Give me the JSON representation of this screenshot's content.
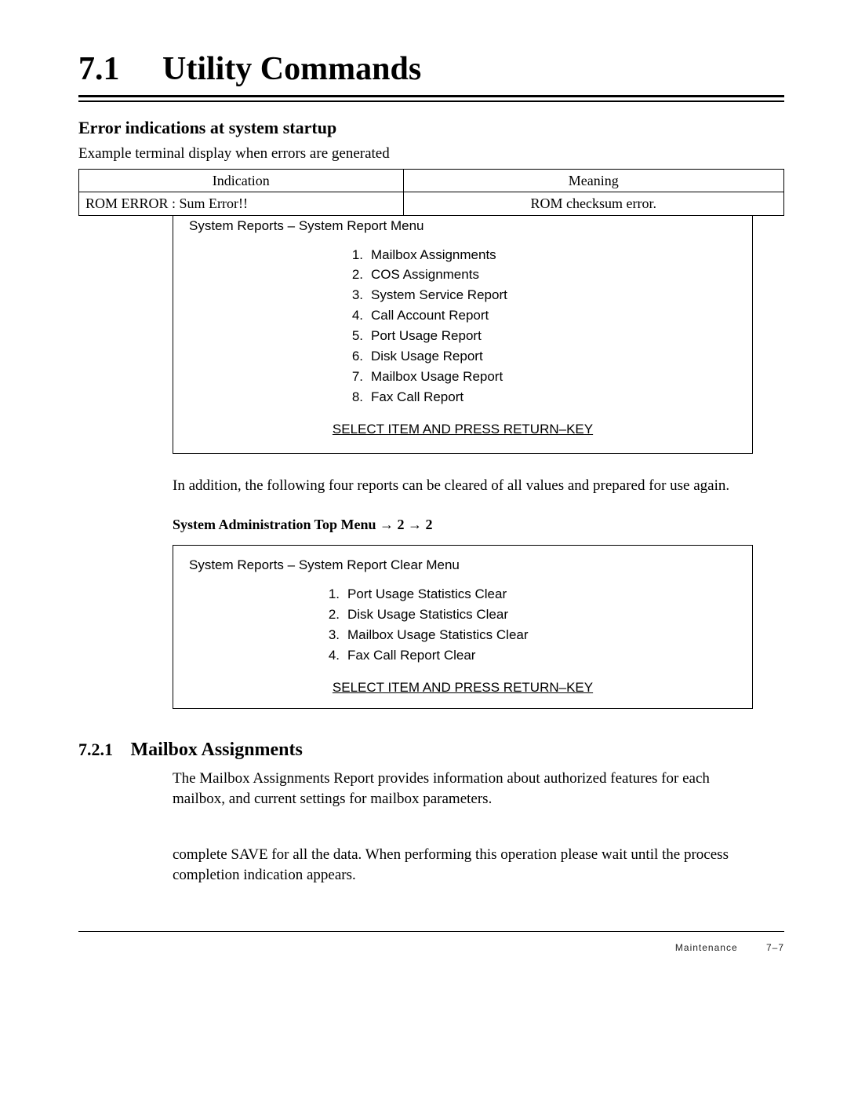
{
  "header": {
    "number": "7.1",
    "title": "Utility Commands"
  },
  "sub1": {
    "title": "Error indications at system startup",
    "intro": "Example terminal display when errors are generated"
  },
  "error_table": {
    "head_indication": "Indication",
    "head_meaning": "Meaning",
    "row_indication": "ROM ERROR : Sum Error!!",
    "row_meaning": "ROM checksum error."
  },
  "terminal1": {
    "title": "System Reports – System Report Menu",
    "items": [
      {
        "n": "1.",
        "label": "Mailbox Assignments"
      },
      {
        "n": "2.",
        "label": "COS Assignments"
      },
      {
        "n": "3.",
        "label": "System Service Report"
      },
      {
        "n": "4.",
        "label": "Call Account Report"
      },
      {
        "n": "5.",
        "label": "Port Usage Report"
      },
      {
        "n": "6.",
        "label": "Disk Usage Report"
      },
      {
        "n": "7.",
        "label": "Mailbox Usage Report"
      },
      {
        "n": "8.",
        "label": "Fax Call Report"
      }
    ],
    "select": "SELECT ITEM AND PRESS RETURN–KEY"
  },
  "para1": "In addition, the following four reports can be cleared of all values and prepared for use again.",
  "menu_path": "System Administration Top Menu → 2 → 2",
  "terminal2": {
    "title": "System Reports – System Report Clear Menu",
    "items": [
      {
        "n": "1.",
        "label": "Port Usage Statistics Clear"
      },
      {
        "n": "2.",
        "label": "Disk Usage Statistics Clear"
      },
      {
        "n": "3.",
        "label": "Mailbox Usage Statistics Clear"
      },
      {
        "n": "4.",
        "label": "Fax Call Report Clear"
      }
    ],
    "select": "SELECT ITEM AND PRESS RETURN–KEY"
  },
  "sub721": {
    "number": "7.2.1",
    "title": "Mailbox Assignments",
    "para": "The Mailbox Assignments Report provides information about authorized features for each mailbox, and current settings for mailbox parameters."
  },
  "tail_para": "complete SAVE for all the data. When performing this operation please wait until the process completion indication appears.",
  "footer": {
    "label": "Maintenance",
    "page": "7–7"
  }
}
